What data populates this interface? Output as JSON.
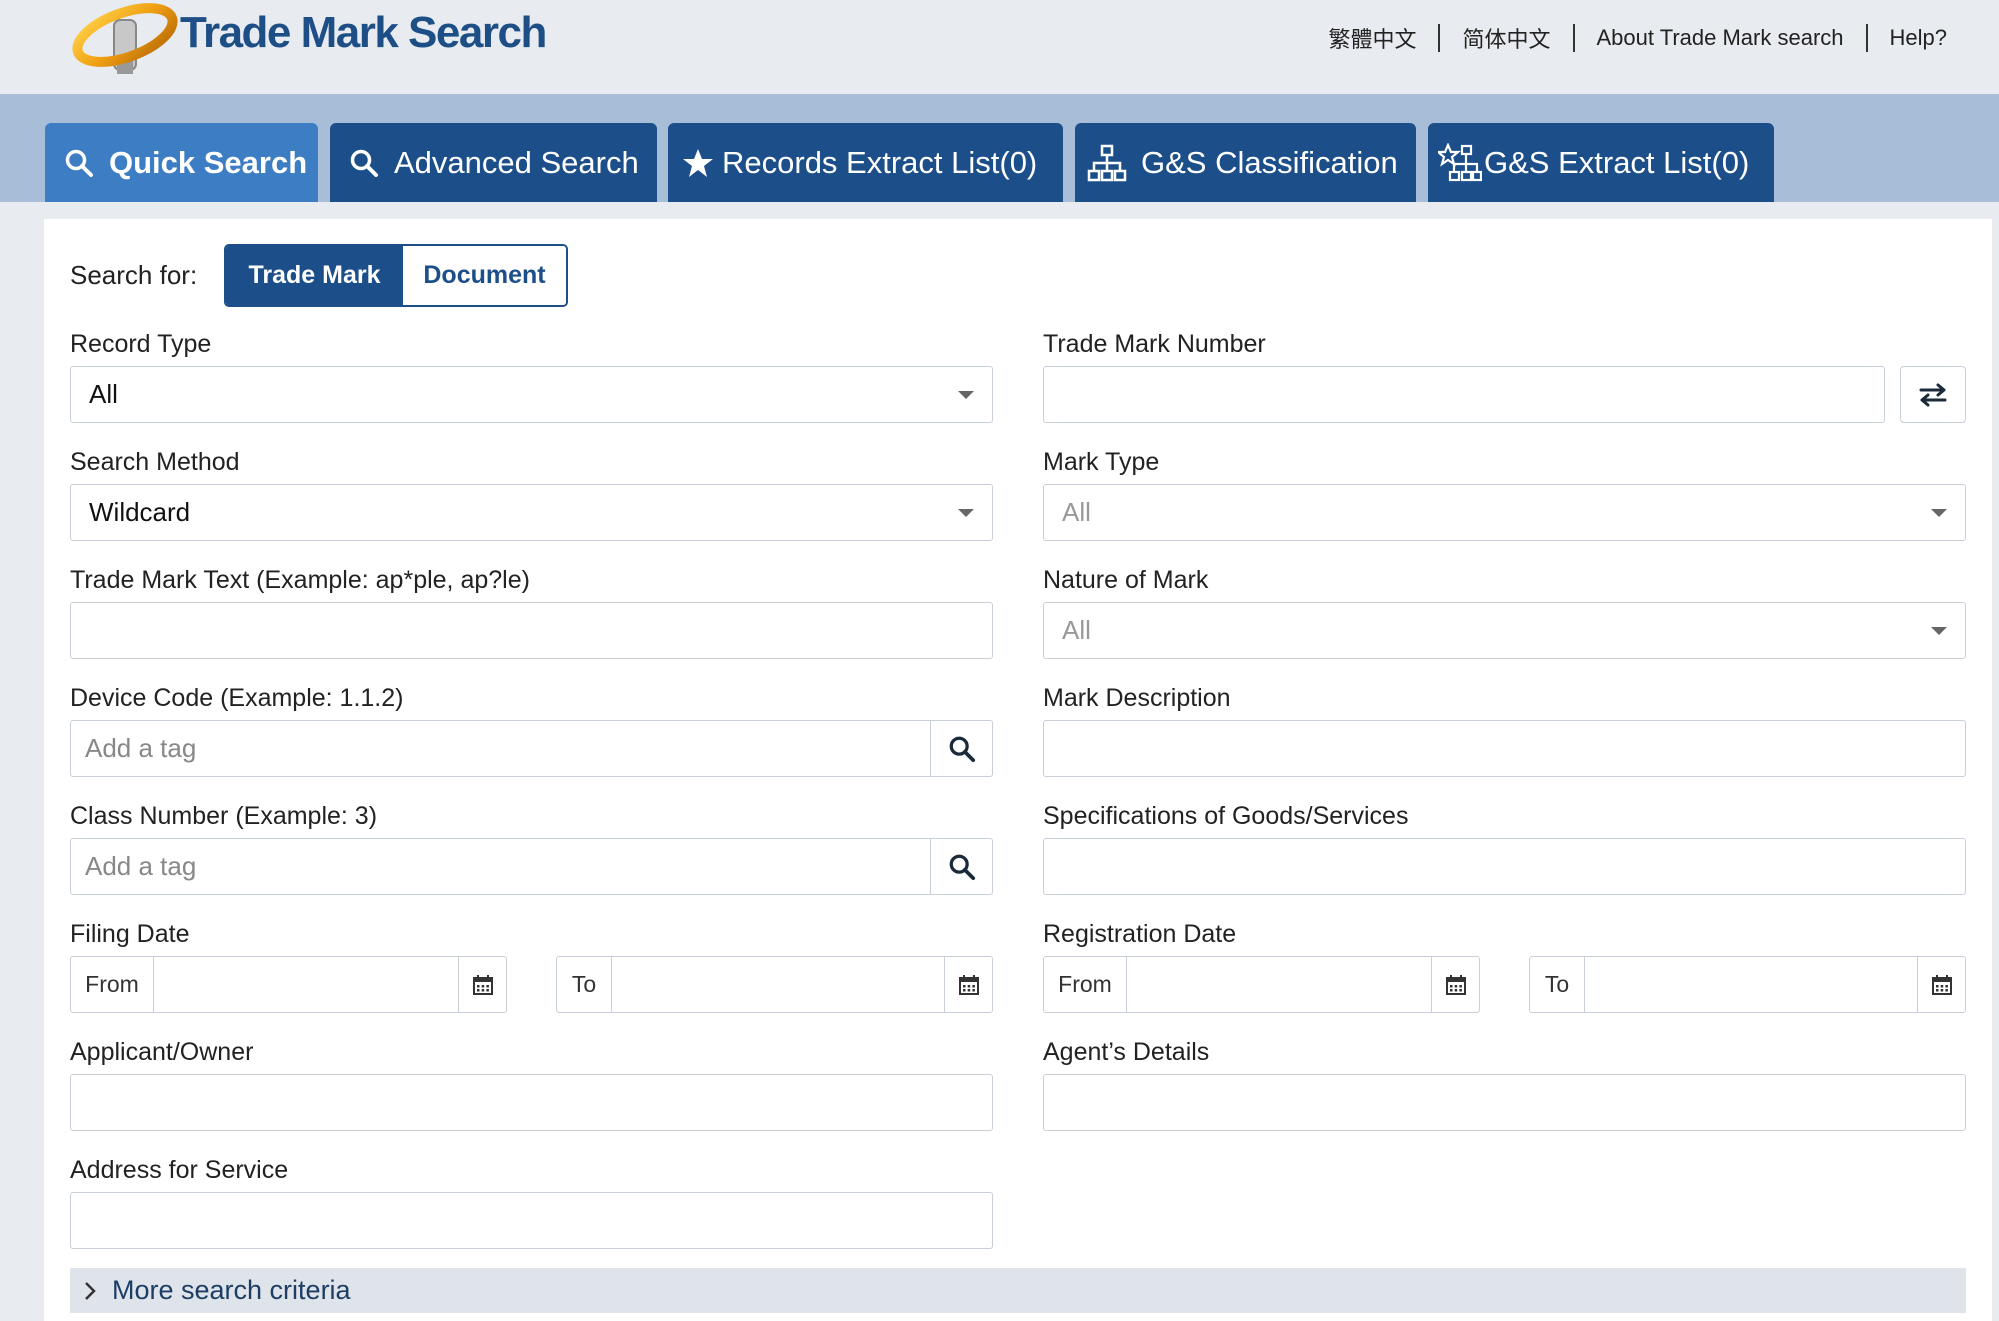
{
  "header": {
    "brand": "Trade Mark Search",
    "links": [
      "繁體中文",
      "简体中文",
      "About Trade Mark search",
      "Help?"
    ]
  },
  "tabs": [
    {
      "label": "Quick Search",
      "icon": "search-icon"
    },
    {
      "label": "Advanced Search",
      "icon": "search-icon"
    },
    {
      "label": "Records Extract List(0)",
      "icon": "star-icon"
    },
    {
      "label": "G&S Classification",
      "icon": "hierarchy-icon"
    },
    {
      "label": "G&S Extract List(0)",
      "icon": "star-hierarchy-icon"
    }
  ],
  "search_for": {
    "label": "Search for:",
    "options": [
      "Trade Mark",
      "Document"
    ],
    "selected": "Trade Mark"
  },
  "form": {
    "record_type": {
      "label": "Record Type",
      "value": "All"
    },
    "trade_mark_number": {
      "label": "Trade Mark Number",
      "value": ""
    },
    "search_method": {
      "label": "Search Method",
      "value": "Wildcard"
    },
    "mark_type": {
      "label": "Mark Type",
      "value": "All"
    },
    "trade_mark_text": {
      "label": "Trade Mark Text (Example: ap*ple, ap?le)",
      "value": ""
    },
    "nature_of_mark": {
      "label": "Nature of Mark",
      "value": "All"
    },
    "device_code": {
      "label": "Device Code (Example: 1.1.2)",
      "placeholder": "Add a tag"
    },
    "mark_description": {
      "label": "Mark Description",
      "value": ""
    },
    "class_number": {
      "label": "Class Number (Example: 3)",
      "placeholder": "Add a tag"
    },
    "specifications": {
      "label": "Specifications of Goods/Services",
      "value": ""
    },
    "filing_date": {
      "label": "Filing Date",
      "from": "From",
      "to": "To"
    },
    "registration_date": {
      "label": "Registration Date",
      "from": "From",
      "to": "To"
    },
    "applicant": {
      "label": "Applicant/Owner",
      "value": ""
    },
    "agent": {
      "label": "Agent’s Details",
      "value": ""
    },
    "address": {
      "label": "Address for Service",
      "value": ""
    }
  },
  "more_criteria": "More search criteria",
  "colors": {
    "brand_blue": "#1c4f8a",
    "active_tab": "#3c7dc4",
    "tab_bar": "#a7bdd8"
  }
}
